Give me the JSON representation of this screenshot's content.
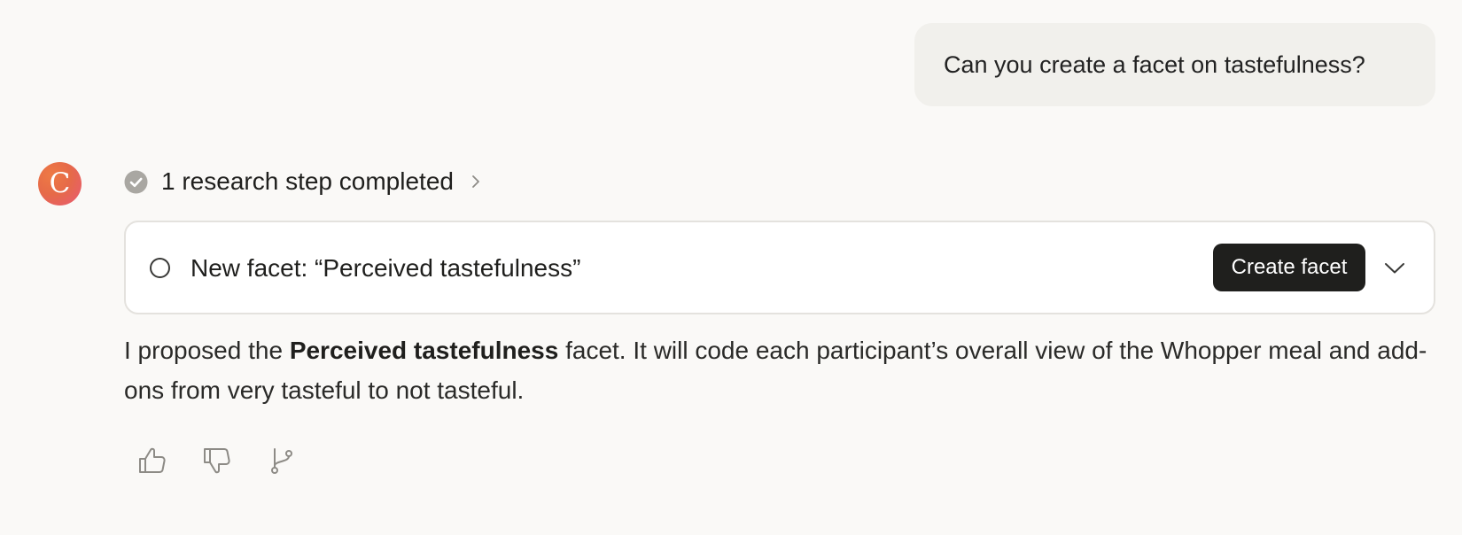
{
  "user_message": {
    "text": "Can you create a facet on tastefulness?"
  },
  "assistant": {
    "avatar_letter": "C",
    "research": {
      "label": "1 research step completed",
      "icon": "check-circle-icon"
    },
    "facet_card": {
      "title": "New facet: “Perceived tastefulness”",
      "button_label": "Create facet",
      "expand_icon": "chevron-down-icon"
    },
    "response": {
      "prefix": "I proposed the ",
      "bold": "Perceived tastefulness",
      "suffix": " facet. It will code each participant’s overall view of the Whopper meal and add-ons from very tasteful to not tasteful."
    },
    "actions": [
      {
        "name": "thumbs-up",
        "icon": "thumbs-up-icon"
      },
      {
        "name": "thumbs-down",
        "icon": "thumbs-down-icon"
      },
      {
        "name": "branch",
        "icon": "branch-icon"
      }
    ]
  },
  "colors": {
    "background": "#faf9f7",
    "user_bubble": "#f1f0ec",
    "button": "#1f1f1d",
    "avatar_gradient_start": "#ee7a45",
    "avatar_gradient_end": "#e85a76"
  }
}
